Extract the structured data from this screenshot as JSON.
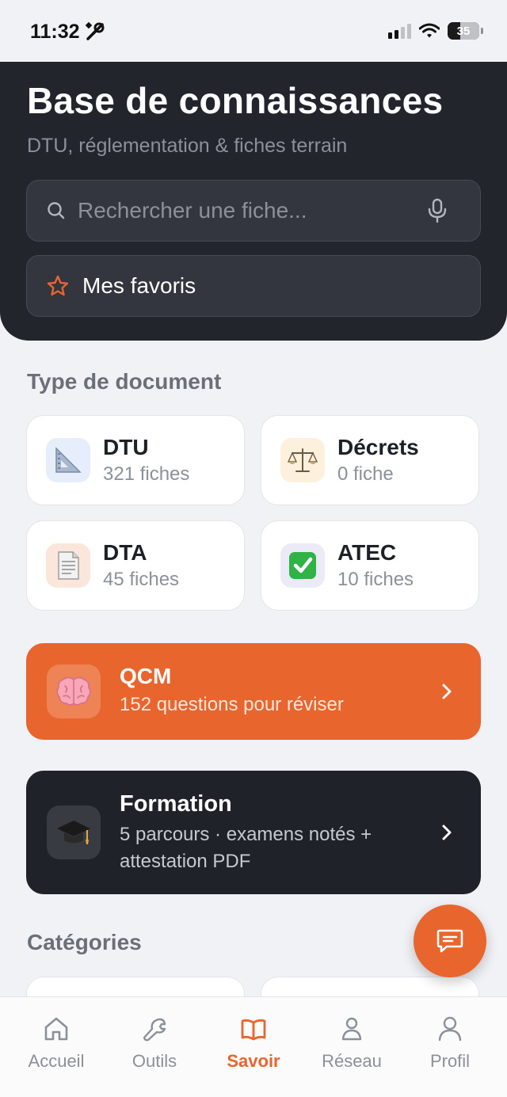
{
  "status_bar": {
    "time": "11:32",
    "battery": "35"
  },
  "header": {
    "title": "Base de connaissances",
    "subtitle": "DTU, réglementation & fiches terrain",
    "search_placeholder": "Rechercher une fiche...",
    "favorites_label": "Mes favoris"
  },
  "doc_types": {
    "heading": "Type de document",
    "items": [
      {
        "title": "DTU",
        "count": "321 fiches",
        "icon": "set-square-icon"
      },
      {
        "title": "Décrets",
        "count": "0 fiche",
        "icon": "scales-icon"
      },
      {
        "title": "DTA",
        "count": "45 fiches",
        "icon": "document-icon"
      },
      {
        "title": "ATEC",
        "count": "10 fiches",
        "icon": "check-mark-icon"
      }
    ]
  },
  "qcm": {
    "title": "QCM",
    "subtitle": "152 questions pour réviser",
    "icon": "brain-icon"
  },
  "formation": {
    "title": "Formation",
    "subtitle": "5 parcours · examens notés + attestation PDF",
    "icon": "graduation-cap-icon"
  },
  "categories": {
    "heading": "Catégories"
  },
  "nav": {
    "items": [
      {
        "label": "Accueil",
        "icon": "home-icon"
      },
      {
        "label": "Outils",
        "icon": "wrench-icon"
      },
      {
        "label": "Savoir",
        "icon": "book-icon",
        "active": true
      },
      {
        "label": "Réseau",
        "icon": "person-icon"
      },
      {
        "label": "Profil",
        "icon": "user-icon"
      }
    ]
  },
  "colors": {
    "accent": "#e8652e",
    "dark": "#22252c",
    "background": "#f1f2f5"
  }
}
